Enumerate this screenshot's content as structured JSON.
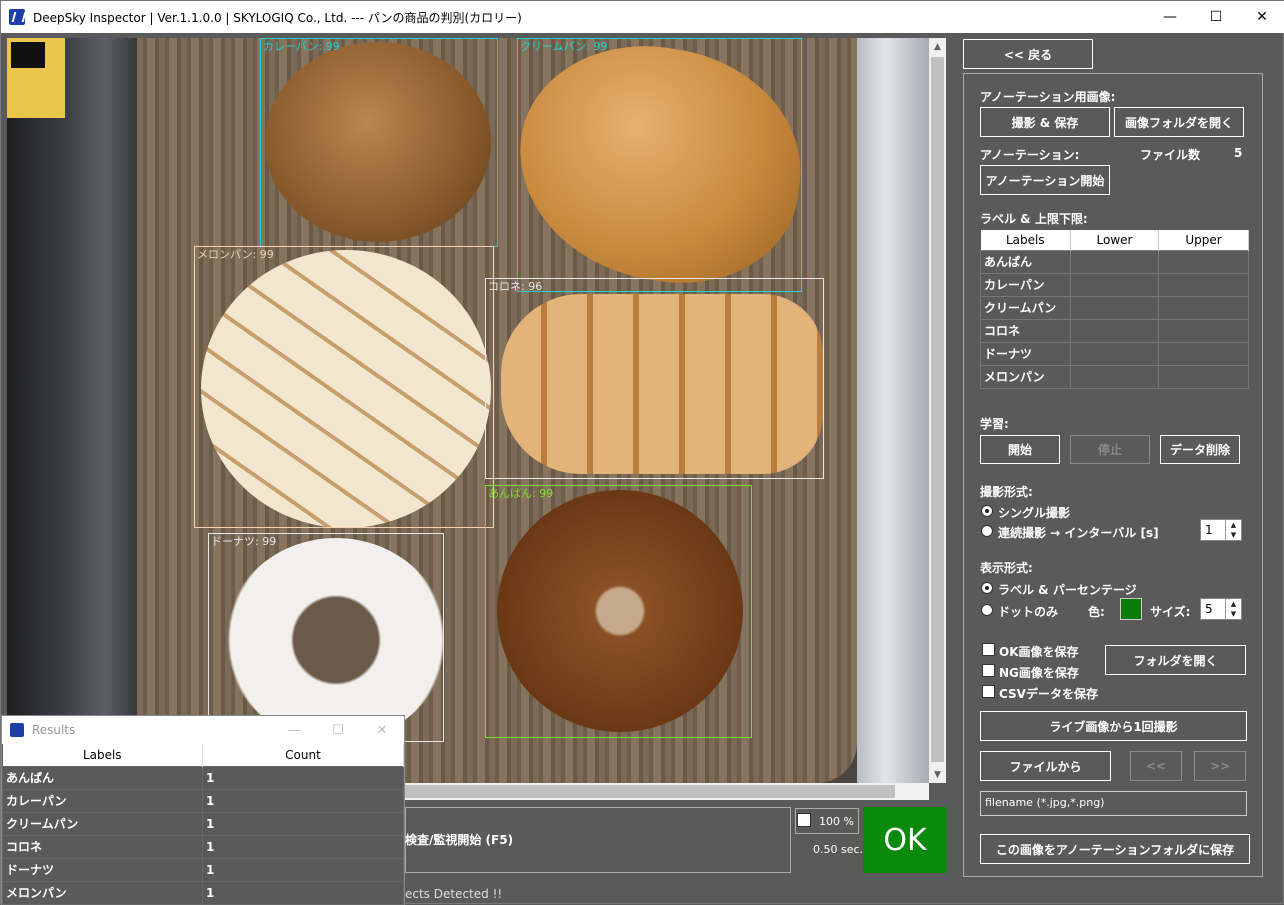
{
  "window": {
    "title": "DeepSky Inspector | Ver.1.1.0.0 | SKYLOGIQ Co., Ltd. --- パンの商品の判別(カロリー)",
    "minimize": "—",
    "maximize": "☐",
    "close": "✕"
  },
  "viewer": {
    "detections": [
      {
        "label": "カレーパン: 99",
        "color": "#22d3d3"
      },
      {
        "label": "クリームパン: 99",
        "color": "#22d3d3"
      },
      {
        "label": "メロンパン: 99",
        "color": "#f3d2b4"
      },
      {
        "label": "コロネ: 96",
        "color": "#e8e8e8"
      },
      {
        "label": "ドーナツ: 99",
        "color": "#e8e8e8"
      },
      {
        "label": "あんぱん: 99",
        "color": "#7ee02a"
      }
    ]
  },
  "results": {
    "title": "Results",
    "columns": [
      "Labels",
      "Count"
    ],
    "rows": [
      {
        "label": "あんぱん",
        "count": "1"
      },
      {
        "label": "カレーパン",
        "count": "1"
      },
      {
        "label": "クリームパン",
        "count": "1"
      },
      {
        "label": "コロネ",
        "count": "1"
      },
      {
        "label": "ドーナツ",
        "count": "1"
      },
      {
        "label": "メロンパン",
        "count": "1"
      }
    ]
  },
  "run": {
    "start_label": "検査/監視開始 (F5)",
    "percent": "100 %",
    "seconds": "0.50 sec.",
    "result": "OK",
    "status": "ects Detected !!"
  },
  "panel": {
    "back": "<< 戻る",
    "annotation_images": "アノーテーション用画像:",
    "capture_save": "撮影 & 保存",
    "open_image_folder": "画像フォルダを開く",
    "annotation": "アノーテーション:",
    "file_count_label": "ファイル数",
    "file_count": "5",
    "start_annotation": "アノーテーション開始",
    "label_limits": "ラベル & 上限下限:",
    "label_columns": [
      "Labels",
      "Lower",
      "Upper"
    ],
    "labels": [
      "あんぱん",
      "カレーパン",
      "クリームパン",
      "コロネ",
      "ドーナツ",
      "メロンパン"
    ],
    "learning": "学習:",
    "learn_start": "開始",
    "learn_stop": "停止",
    "learn_delete": "データ削除",
    "capture_mode": "撮影形式:",
    "single": "シングル撮影",
    "continuous": "連続撮影 → インターバル [s]",
    "interval": "1",
    "display_mode": "表示形式:",
    "label_percent": "ラベル & パーセンテージ",
    "dot_only": "ドットのみ",
    "color_label": "色:",
    "color": "#0a7a0a",
    "size_label": "サイズ:",
    "size": "5",
    "save_ok": "OK画像を保存",
    "save_ng": "NG画像を保存",
    "save_csv": "CSVデータを保存",
    "open_folder": "フォルダを開く",
    "live_capture": "ライブ画像から1回撮影",
    "from_file": "ファイルから",
    "prev": "<<",
    "next": ">>",
    "filename_placeholder": "filename (*.jpg,*.png)",
    "save_to_annotation": "この画像をアノーテーションフォルダに保存"
  }
}
